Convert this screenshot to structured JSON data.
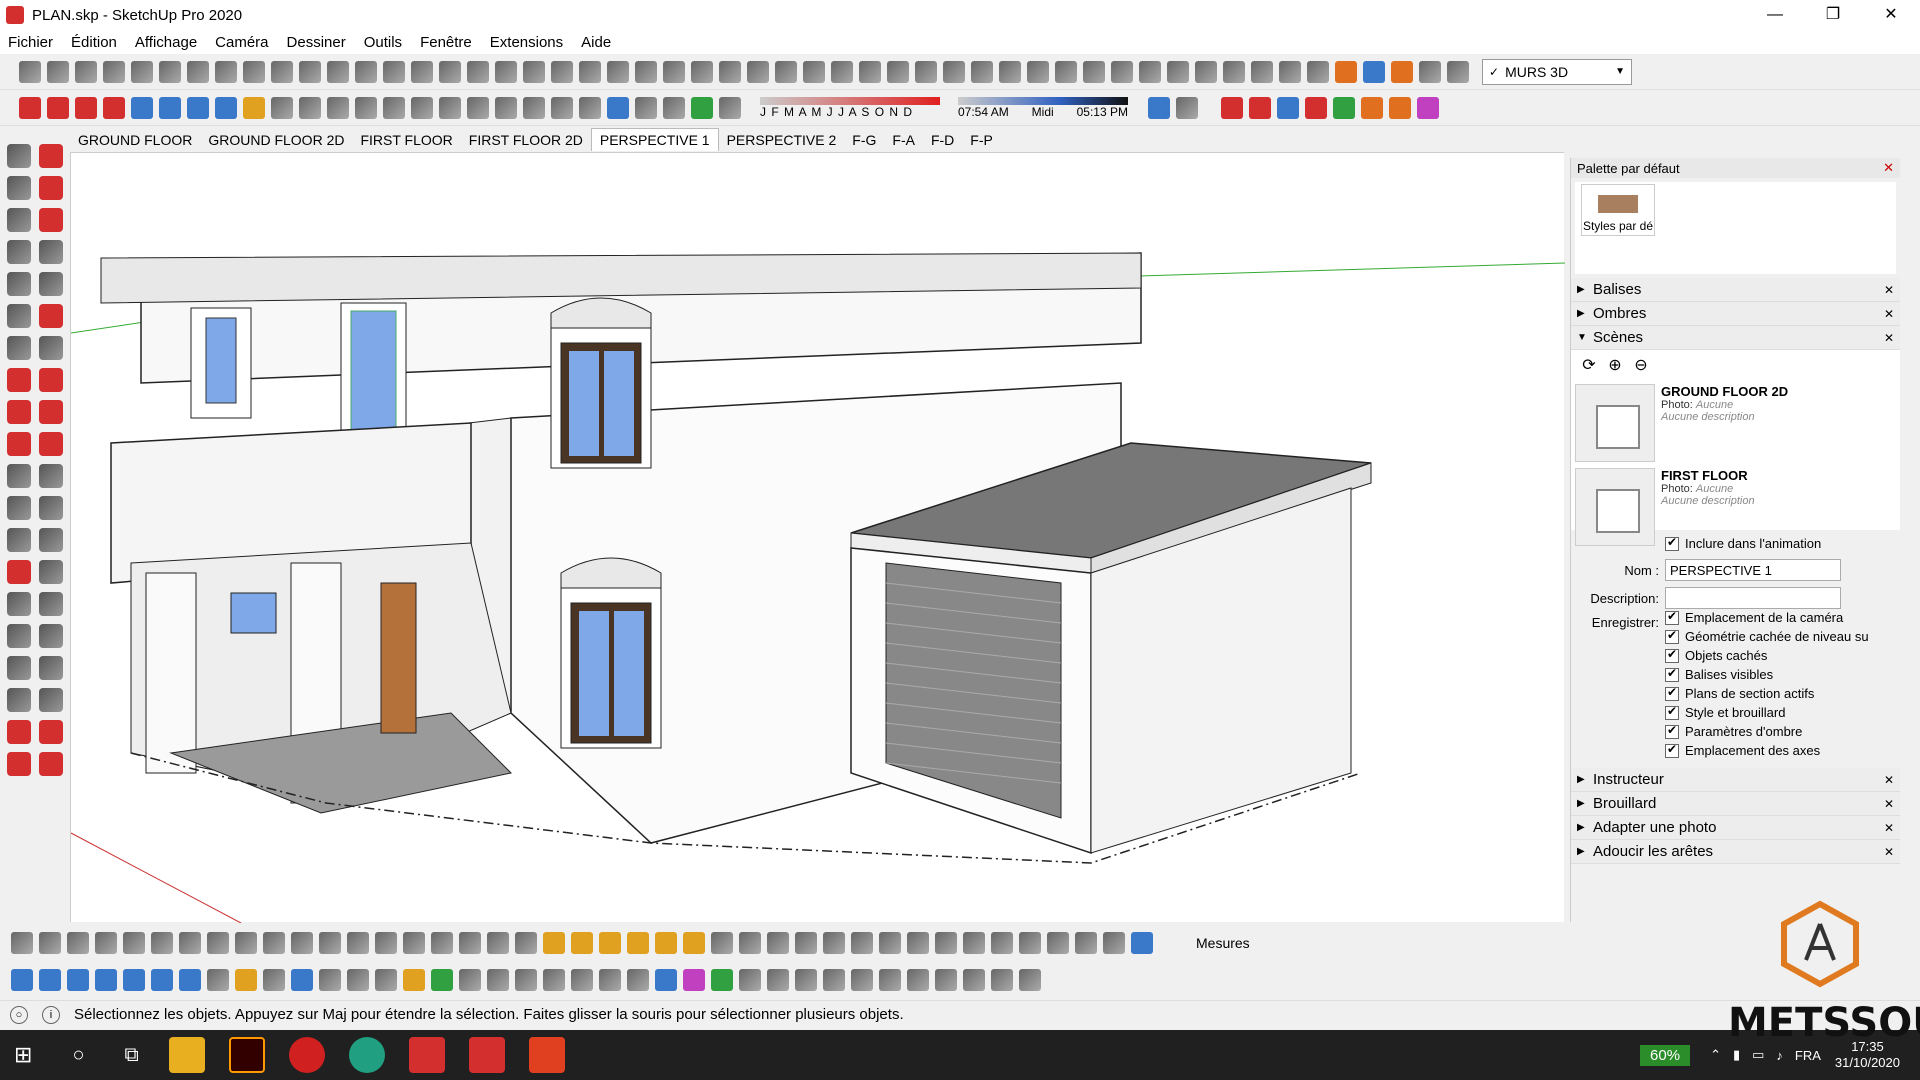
{
  "window": {
    "title": "PLAN.skp - SketchUp Pro 2020",
    "minimize": "—",
    "maximize": "❐",
    "close": "✕"
  },
  "menu": [
    "Fichier",
    "Édition",
    "Affichage",
    "Caméra",
    "Dessiner",
    "Outils",
    "Fenêtre",
    "Extensions",
    "Aide"
  ],
  "layer_dropdown": {
    "value": "MURS 3D",
    "check": "✓"
  },
  "shadow": {
    "months": "J F M A M J J A S O N D",
    "time_start": "07:54 AM",
    "time_mid": "Midi",
    "time_end": "05:13 PM"
  },
  "scene_tabs": [
    "GROUND FLOOR",
    "GROUND FLOOR 2D",
    "FIRST FLOOR",
    "FIRST FLOOR 2D",
    "PERSPECTIVE 1",
    "PERSPECTIVE 2",
    "F-G",
    "F-A",
    "F-D",
    "F-P"
  ],
  "active_tab_index": 4,
  "panel": {
    "title": "Palette par défaut",
    "style_label": "Styles par dé",
    "sections_top": [
      "Balises",
      "Ombres",
      "Scènes"
    ],
    "scenes": [
      {
        "name": "GROUND FLOOR 2D",
        "photo": "Photo:",
        "photo_val": "Aucune",
        "desc": "Aucune description"
      },
      {
        "name": "FIRST FLOOR",
        "photo": "Photo:",
        "photo_val": "Aucune",
        "desc": "Aucune description"
      }
    ],
    "include_anim": "Inclure dans l'animation",
    "name_label": "Nom :",
    "name_value": "PERSPECTIVE 1",
    "desc_label": "Description:",
    "save_label": "Enregistrer:",
    "save_options": [
      "Emplacement de la caméra",
      "Géométrie cachée de niveau su",
      "Objets cachés",
      "Balises visibles",
      "Plans de section actifs",
      "Style et brouillard",
      "Paramètres d'ombre",
      "Emplacement des axes"
    ],
    "sections_bottom": [
      "Instructeur",
      "Brouillard",
      "Adapter une photo",
      "Adoucir les arêtes"
    ]
  },
  "measures_label": "Mesures",
  "status": "Sélectionnez les objets. Appuyez sur Maj pour étendre la sélection. Faites glisser la souris pour sélectionner plusieurs objets.",
  "taskbar": {
    "battery": "60%",
    "lang": "FRA",
    "time": "17:35",
    "date": "31/10/2020"
  },
  "watermark": "METSSOU",
  "colors": {
    "accent": "#d32f2f",
    "viewport_bg": "#ffffff",
    "garage_roof": "#777777",
    "window_glass": "#7fa8e8"
  }
}
